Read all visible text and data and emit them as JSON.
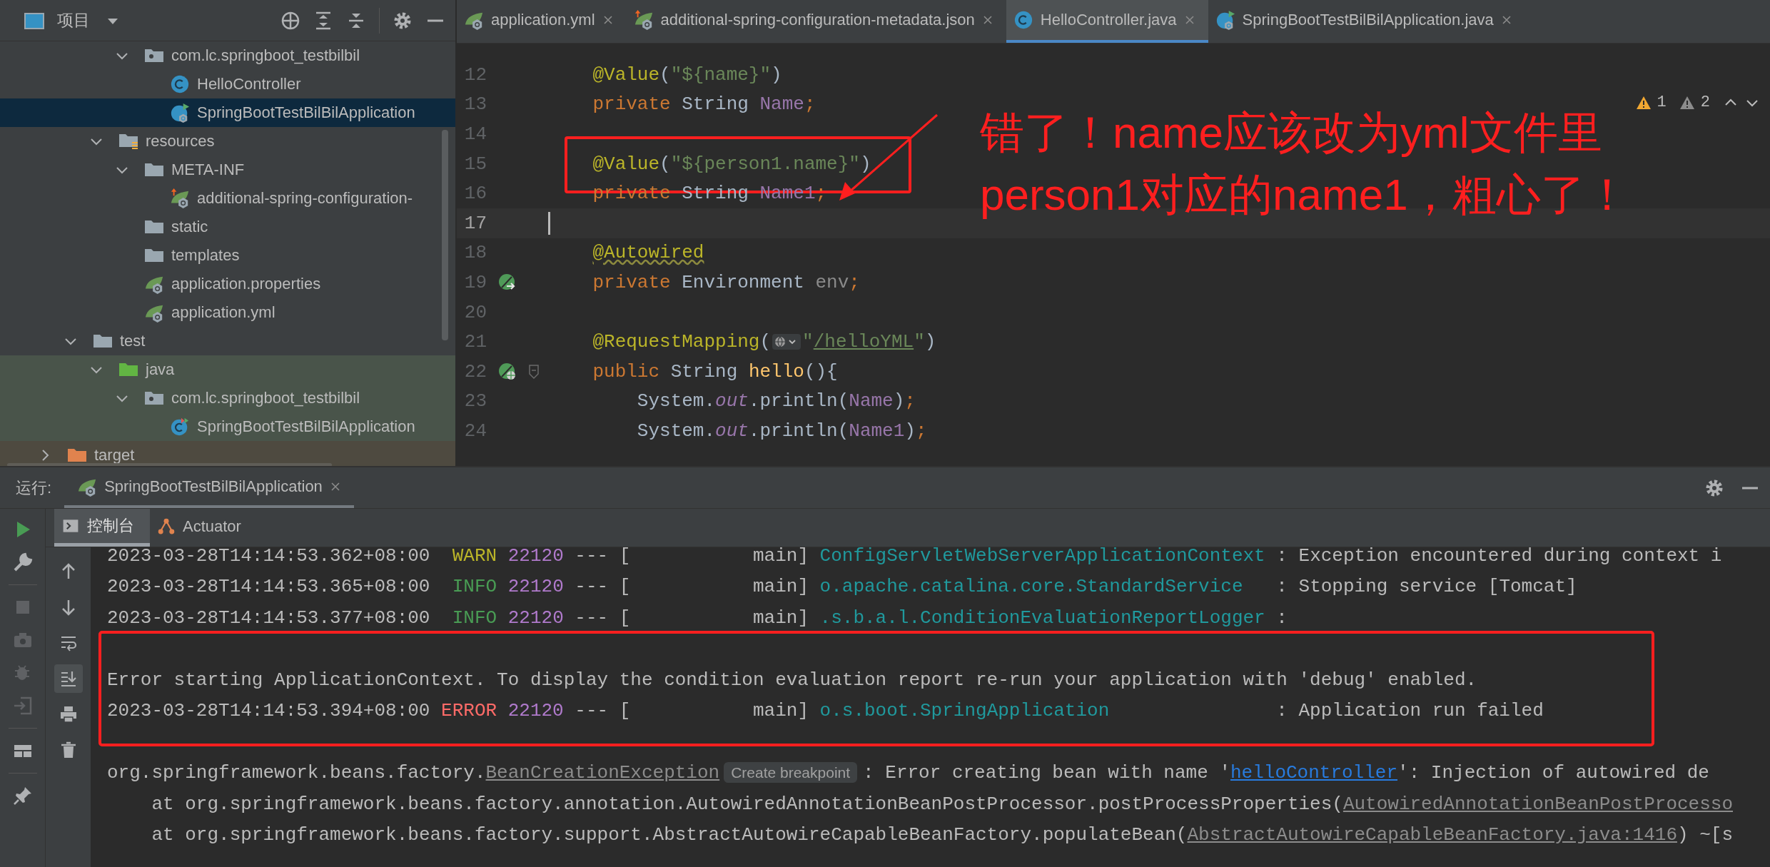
{
  "project_panel": {
    "title": "项目",
    "tree": [
      {
        "children": [
          {
            "children": [
              {
                "children": [
                  {
                    "label": "com.lc.springboot_testbilbil",
                    "kind": "package",
                    "expanded": true,
                    "selected": false,
                    "children": [
                      {
                        "label": "HelloController",
                        "kind": "class",
                        "selected": false
                      },
                      {
                        "label": "SpringBootTestBilBilApplication",
                        "kind": "spring-class",
                        "selected": true
                      }
                    ]
                  }
                ]
              },
              {
                "label": "resources",
                "kind": "resources-folder",
                "expanded": true,
                "selected": false,
                "children": [
                  {
                    "label": "META-INF",
                    "kind": "folder",
                    "expanded": true,
                    "selected": false,
                    "children": [
                      {
                        "label": "additional-spring-configuration-",
                        "kind": "spring-json",
                        "selected": false
                      }
                    ]
                  },
                  {
                    "label": "static",
                    "kind": "folder",
                    "selected": false
                  },
                  {
                    "label": "templates",
                    "kind": "folder",
                    "selected": false
                  },
                  {
                    "label": "application.properties",
                    "kind": "spring-config",
                    "selected": false
                  },
                  {
                    "label": "application.yml",
                    "kind": "spring-config",
                    "selected": false
                  }
                ]
              }
            ]
          },
          {
            "label": "test",
            "kind": "folder",
            "expanded": true,
            "selected": false,
            "children": [
              {
                "label": "java",
                "kind": "test-folder",
                "expanded": true,
                "selected": false,
                "test_source": true,
                "children": [
                  {
                    "label": "com.lc.springboot_testbilbil",
                    "kind": "package",
                    "expanded": true,
                    "selected": false,
                    "test_source": true,
                    "children": [
                      {
                        "label": "SpringBootTestBilBilApplication",
                        "kind": "test-class",
                        "selected": false,
                        "test_source": true
                      }
                    ]
                  }
                ]
              }
            ]
          }
        ]
      },
      {
        "label": "target",
        "kind": "excluded-folder",
        "expanded": false,
        "selected": false,
        "excluded": true
      }
    ]
  },
  "editor": {
    "tabs": [
      {
        "label": "application.yml",
        "kind": "spring-config",
        "selected": false
      },
      {
        "label": "additional-spring-configuration-metadata.json",
        "kind": "spring-json",
        "selected": false
      },
      {
        "label": "HelloController.java",
        "kind": "class",
        "selected": true
      },
      {
        "label": "SpringBootTestBilBilApplication.java",
        "kind": "spring-class",
        "selected": false
      }
    ],
    "inspections": [
      {
        "kind": "warning",
        "count": "1"
      },
      {
        "kind": "weak-warning",
        "count": "2"
      }
    ],
    "lines": [
      {
        "number": "12",
        "current": false,
        "framed": false,
        "tokens": [
          {
            "kind": "annotation",
            "text": "    @Value"
          },
          {
            "kind": "plain",
            "text": "("
          },
          {
            "kind": "string",
            "text": "\"${name}\""
          },
          {
            "kind": "plain",
            "text": ")"
          }
        ]
      },
      {
        "number": "13",
        "current": false,
        "framed": false,
        "tokens": [
          {
            "kind": "keyword",
            "text": "    private"
          },
          {
            "kind": "plain",
            "text": " String "
          },
          {
            "kind": "field",
            "text": "Name"
          },
          {
            "kind": "keyword",
            "text": ";"
          }
        ]
      },
      {
        "number": "14",
        "current": false,
        "framed": false
      },
      {
        "number": "15",
        "current": false,
        "framed": true,
        "tokens": [
          {
            "kind": "annotation",
            "text": "    @Value"
          },
          {
            "kind": "plain",
            "text": "("
          },
          {
            "kind": "string",
            "text": "\"${person1.name}\""
          },
          {
            "kind": "plain",
            "text": ")"
          }
        ]
      },
      {
        "number": "16",
        "current": false,
        "framed": false,
        "tokens": [
          {
            "kind": "keyword",
            "text": "    private"
          },
          {
            "kind": "plain",
            "text": " String "
          },
          {
            "kind": "field",
            "text": "Name1"
          },
          {
            "kind": "keyword",
            "text": ";"
          }
        ]
      },
      {
        "number": "17",
        "current": true,
        "framed": false
      },
      {
        "number": "18",
        "current": false,
        "framed": false,
        "tokens": [
          {
            "kind": "annotation-warning",
            "text": "    @Autowired"
          }
        ]
      },
      {
        "number": "19",
        "current": false,
        "framed": false,
        "gutter": {
          "kind": "bean"
        },
        "tokens": [
          {
            "kind": "keyword",
            "text": "    private"
          },
          {
            "kind": "plain",
            "text": " Environment "
          },
          {
            "kind": "unused",
            "text": "env"
          },
          {
            "kind": "keyword",
            "text": ";"
          }
        ]
      },
      {
        "number": "20",
        "current": false,
        "framed": false
      },
      {
        "number": "21",
        "current": false,
        "framed": false,
        "tokens": [
          {
            "kind": "annotation",
            "text": "    @RequestMapping"
          },
          {
            "kind": "plain",
            "text": "("
          },
          {
            "kind": "url-hint"
          },
          {
            "kind": "string",
            "text": "\""
          },
          {
            "kind": "string-link",
            "text": "/helloYML"
          },
          {
            "kind": "string",
            "text": "\""
          },
          {
            "kind": "plain",
            "text": ")"
          }
        ]
      },
      {
        "number": "22",
        "current": false,
        "framed": false,
        "gutter": {
          "kind": "web"
        },
        "fold": true,
        "tokens": [
          {
            "kind": "keyword",
            "text": "    public"
          },
          {
            "kind": "plain",
            "text": " String "
          },
          {
            "kind": "method",
            "text": "hello"
          },
          {
            "kind": "plain",
            "text": "(){"
          }
        ]
      },
      {
        "number": "23",
        "current": false,
        "framed": false,
        "tokens": [
          {
            "kind": "plain",
            "text": "        System."
          },
          {
            "kind": "static",
            "text": "out"
          },
          {
            "kind": "plain",
            "text": ".println("
          },
          {
            "kind": "field",
            "text": "Name"
          },
          {
            "kind": "plain",
            "text": ")"
          },
          {
            "kind": "keyword",
            "text": ";"
          }
        ]
      },
      {
        "number": "24",
        "current": false,
        "framed": false,
        "tokens": [
          {
            "kind": "plain",
            "text": "        System."
          },
          {
            "kind": "static",
            "text": "out"
          },
          {
            "kind": "plain",
            "text": ".println("
          },
          {
            "kind": "field",
            "text": "Name1"
          },
          {
            "kind": "plain",
            "text": ")"
          },
          {
            "kind": "keyword",
            "text": ";"
          }
        ]
      }
    ],
    "annotation": {
      "lines": [
        "错了！name应该改为yml文件里",
        "person1对应的name1，粗心了！"
      ]
    }
  },
  "run_panel": {
    "label": "运行:",
    "tab": {
      "label": "SpringBootTestBilBilApplication",
      "selected": true
    },
    "tool_tabs": [
      {
        "label": "控制台",
        "kind": "console",
        "selected": true
      },
      {
        "label": "Actuator",
        "kind": "actuator",
        "selected": false
      }
    ],
    "autoscroll": true,
    "console": [
      {
        "kind": "log",
        "framed": false,
        "tokens": [
          {
            "kind": "text",
            "text": "2023-03-28T14:14:53.362+08:00  "
          },
          {
            "kind": "warn",
            "text": "WARN"
          },
          {
            "kind": "pid",
            "text": " 22120"
          },
          {
            "kind": "text",
            "text": " --- [           main] "
          },
          {
            "kind": "logger",
            "text": "ConfigServletWebServerApplicationContext"
          },
          {
            "kind": "text",
            "text": " : Exception encountered during context i"
          }
        ]
      },
      {
        "kind": "log",
        "framed": false,
        "tokens": [
          {
            "kind": "text",
            "text": "2023-03-28T14:14:53.365+08:00  "
          },
          {
            "kind": "info",
            "text": "INFO"
          },
          {
            "kind": "pid",
            "text": " 22120"
          },
          {
            "kind": "text",
            "text": " --- [           main] "
          },
          {
            "kind": "logger",
            "text": "o.apache.catalina.core.StandardService"
          },
          {
            "kind": "text",
            "text": "   : Stopping service [Tomcat]"
          }
        ]
      },
      {
        "kind": "log",
        "framed": false,
        "tokens": [
          {
            "kind": "text",
            "text": "2023-03-28T14:14:53.377+08:00  "
          },
          {
            "kind": "info",
            "text": "INFO"
          },
          {
            "kind": "pid",
            "text": " 22120"
          },
          {
            "kind": "text",
            "text": " --- [           main] "
          },
          {
            "kind": "logger",
            "text": ".s.b.a.l.ConditionEvaluationReportLogger"
          },
          {
            "kind": "text",
            "text": " :"
          }
        ]
      },
      {
        "kind": "blank",
        "framed": true
      },
      {
        "kind": "log",
        "framed": true,
        "tokens": [
          {
            "kind": "text",
            "text": "Error starting ApplicationContext. To display the condition evaluation report re-run your application with 'debug' enabled."
          }
        ]
      },
      {
        "kind": "log",
        "framed": true,
        "tokens": [
          {
            "kind": "text",
            "text": "2023-03-28T14:14:53.394+08:00 "
          },
          {
            "kind": "error",
            "text": "ERROR"
          },
          {
            "kind": "pid",
            "text": " 22120"
          },
          {
            "kind": "text",
            "text": " --- [           main] "
          },
          {
            "kind": "logger",
            "text": "o.s.boot.SpringApplication"
          },
          {
            "kind": "text",
            "text": "               : Application run failed"
          }
        ]
      },
      {
        "kind": "blank",
        "framed": false
      },
      {
        "kind": "log",
        "framed": false,
        "tokens": [
          {
            "kind": "text",
            "text": "org.springframework.beans.factory."
          },
          {
            "kind": "source-link",
            "text": "BeanCreationException"
          },
          {
            "kind": "hint",
            "text": "Create breakpoint"
          },
          {
            "kind": "text",
            "text": ": Error creating bean with name '"
          },
          {
            "kind": "link",
            "text": "helloController"
          },
          {
            "kind": "text",
            "text": "': Injection of autowired de"
          }
        ]
      },
      {
        "kind": "log",
        "framed": false,
        "tokens": [
          {
            "kind": "text",
            "text": "    at org.springframework.beans.factory.annotation.AutowiredAnnotationBeanPostProcessor.postProcessProperties("
          },
          {
            "kind": "source-link",
            "text": "AutowiredAnnotationBeanPostProcesso"
          }
        ]
      },
      {
        "kind": "log",
        "framed": false,
        "tokens": [
          {
            "kind": "text",
            "text": "    at org.springframework.beans.factory.support.AbstractAutowireCapableBeanFactory.populateBean("
          },
          {
            "kind": "source-link",
            "text": "AbstractAutowireCapableBeanFactory.java:1416"
          },
          {
            "kind": "text",
            "text": ") ~[s"
          }
        ]
      }
    ]
  }
}
